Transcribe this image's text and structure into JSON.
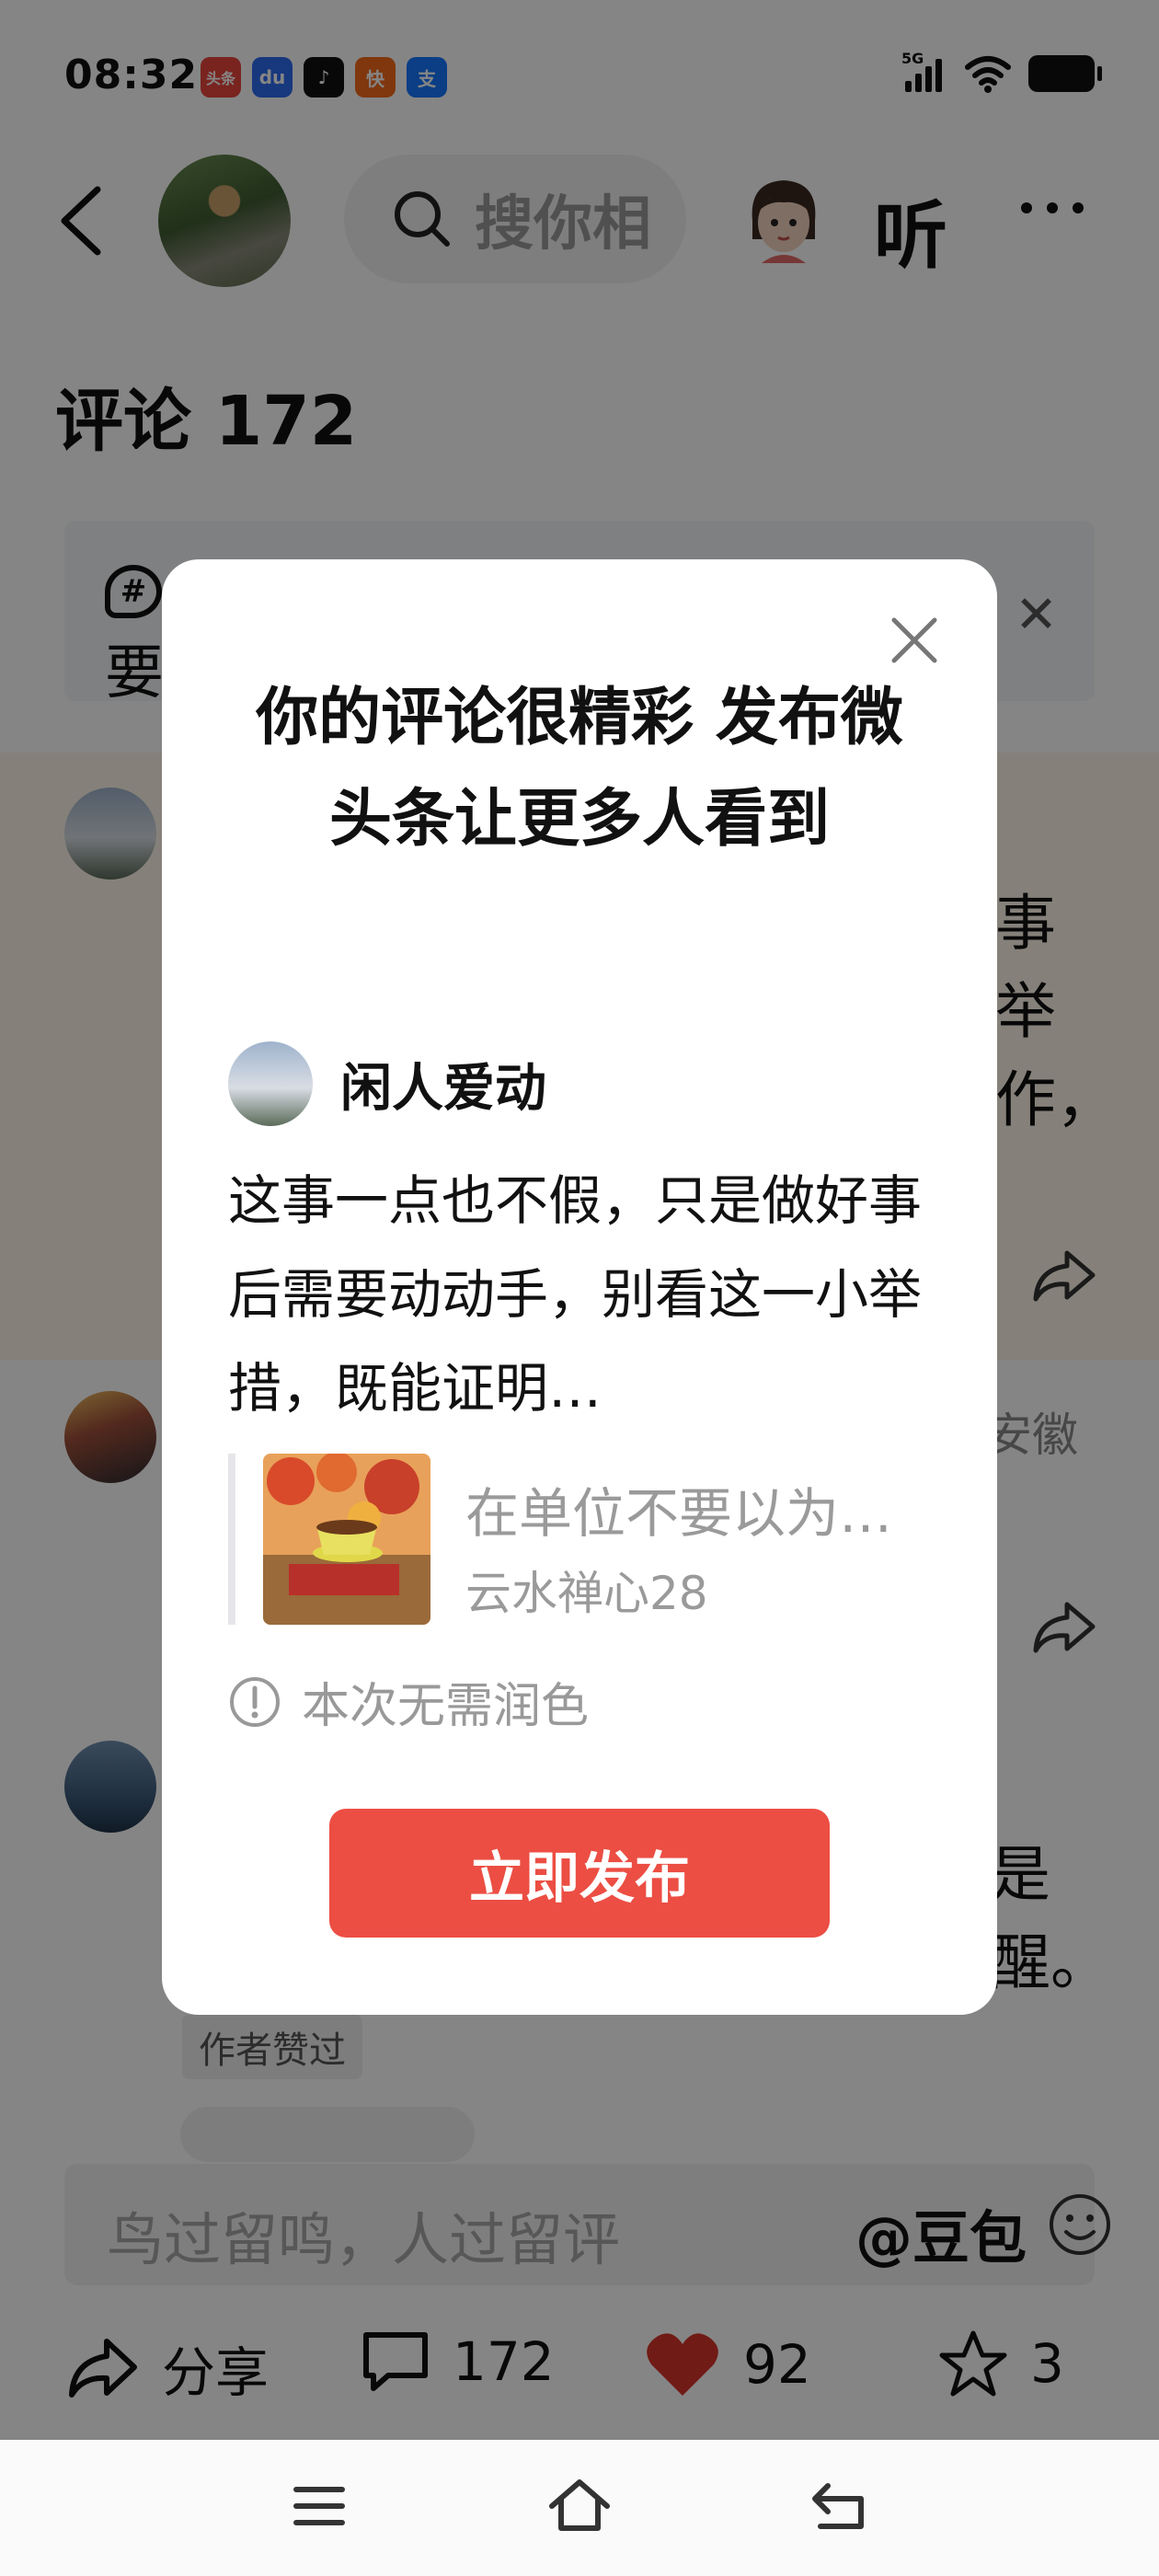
{
  "status_bar": {
    "time": "08:32",
    "app_icons": [
      {
        "name": "toutiao-icon",
        "label": "头条",
        "color": "#e8463c"
      },
      {
        "name": "baidu-icon",
        "label": "du",
        "color": "#2f6bf2"
      },
      {
        "name": "douyin-icon",
        "label": "♪",
        "color": "#111111"
      },
      {
        "name": "kuaishou-icon",
        "label": "快",
        "color": "#f56a1c"
      },
      {
        "name": "alipay-icon",
        "label": "支",
        "color": "#1677ff"
      }
    ],
    "network": "5G"
  },
  "nav": {
    "search_placeholder": "搜你相",
    "listen_label": "听"
  },
  "comments": {
    "title": "评论 172",
    "topic_prefix": "要",
    "bg_fragments": [
      "事",
      "举",
      "作，",
      "安徽",
      "是",
      "醒。"
    ],
    "author_liked": "作者赞过"
  },
  "input": {
    "placeholder": "鸟过留鸣，人过留评",
    "ai_mention": "@豆包"
  },
  "actions": {
    "share_label": "分享",
    "comments_count": "172",
    "likes_count": "92",
    "favorites_count": "3"
  },
  "modal": {
    "title": "你的评论很精彩 发布微头条让更多人看到",
    "author_name": "闲人爱动",
    "body": "这事一点也不假，只是做好事后需要动动手，别看这一小举措，既能证明…",
    "quote_title": "在单位不要以为…",
    "quote_source": "云水禅心28",
    "tip": "本次无需润色",
    "publish_label": "立即发布"
  },
  "colors": {
    "accent": "#ec4e43",
    "like_red": "#d9342b",
    "highlight_row": "#fff8ea"
  }
}
